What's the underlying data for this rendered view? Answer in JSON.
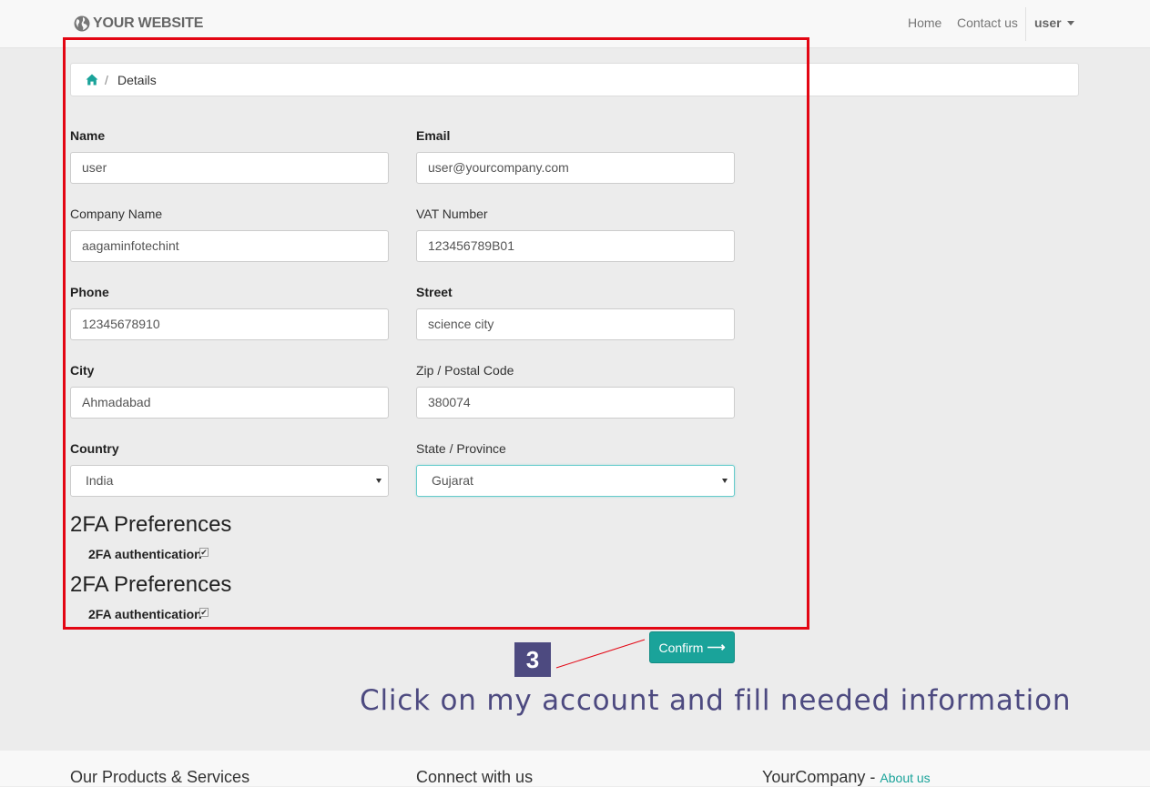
{
  "navbar": {
    "brand": "YOUR WEBSITE",
    "links": [
      "Home",
      "Contact us"
    ],
    "user": "user"
  },
  "breadcrumb": {
    "separator": "/",
    "current": "Details"
  },
  "form": {
    "name": {
      "label": "Name",
      "value": "user"
    },
    "email": {
      "label": "Email",
      "value": "user@yourcompany.com"
    },
    "company": {
      "label": "Company Name",
      "value": "aagaminfotechint"
    },
    "vat": {
      "label": "VAT Number",
      "value": "123456789B01"
    },
    "phone": {
      "label": "Phone",
      "value": "12345678910"
    },
    "street": {
      "label": "Street",
      "value": "science city"
    },
    "city": {
      "label": "City",
      "value": "Ahmadabad"
    },
    "zip": {
      "label": "Zip / Postal Code",
      "value": "380074"
    },
    "country": {
      "label": "Country",
      "value": "India"
    },
    "state": {
      "label": "State / Province",
      "value": "Gujarat"
    }
  },
  "preferences": [
    {
      "title": "2FA Preferences",
      "option": "2FA authentication",
      "checked": true
    },
    {
      "title": "2FA Preferences",
      "option": "2FA authentication",
      "checked": true
    }
  ],
  "confirm": {
    "label": "Confirm",
    "arrow": "⟶"
  },
  "annotation": {
    "step": "3",
    "text": "Click on my account and fill needed information",
    "color": "#4d4a80",
    "highlight_color": "#e30613"
  },
  "footer": {
    "col1": "Our Products & Services",
    "col2": "Connect with us",
    "col3": "YourCompany",
    "col3_sep": " - ",
    "col3_link": "About us"
  },
  "colors": {
    "accent": "#1aa39a"
  }
}
